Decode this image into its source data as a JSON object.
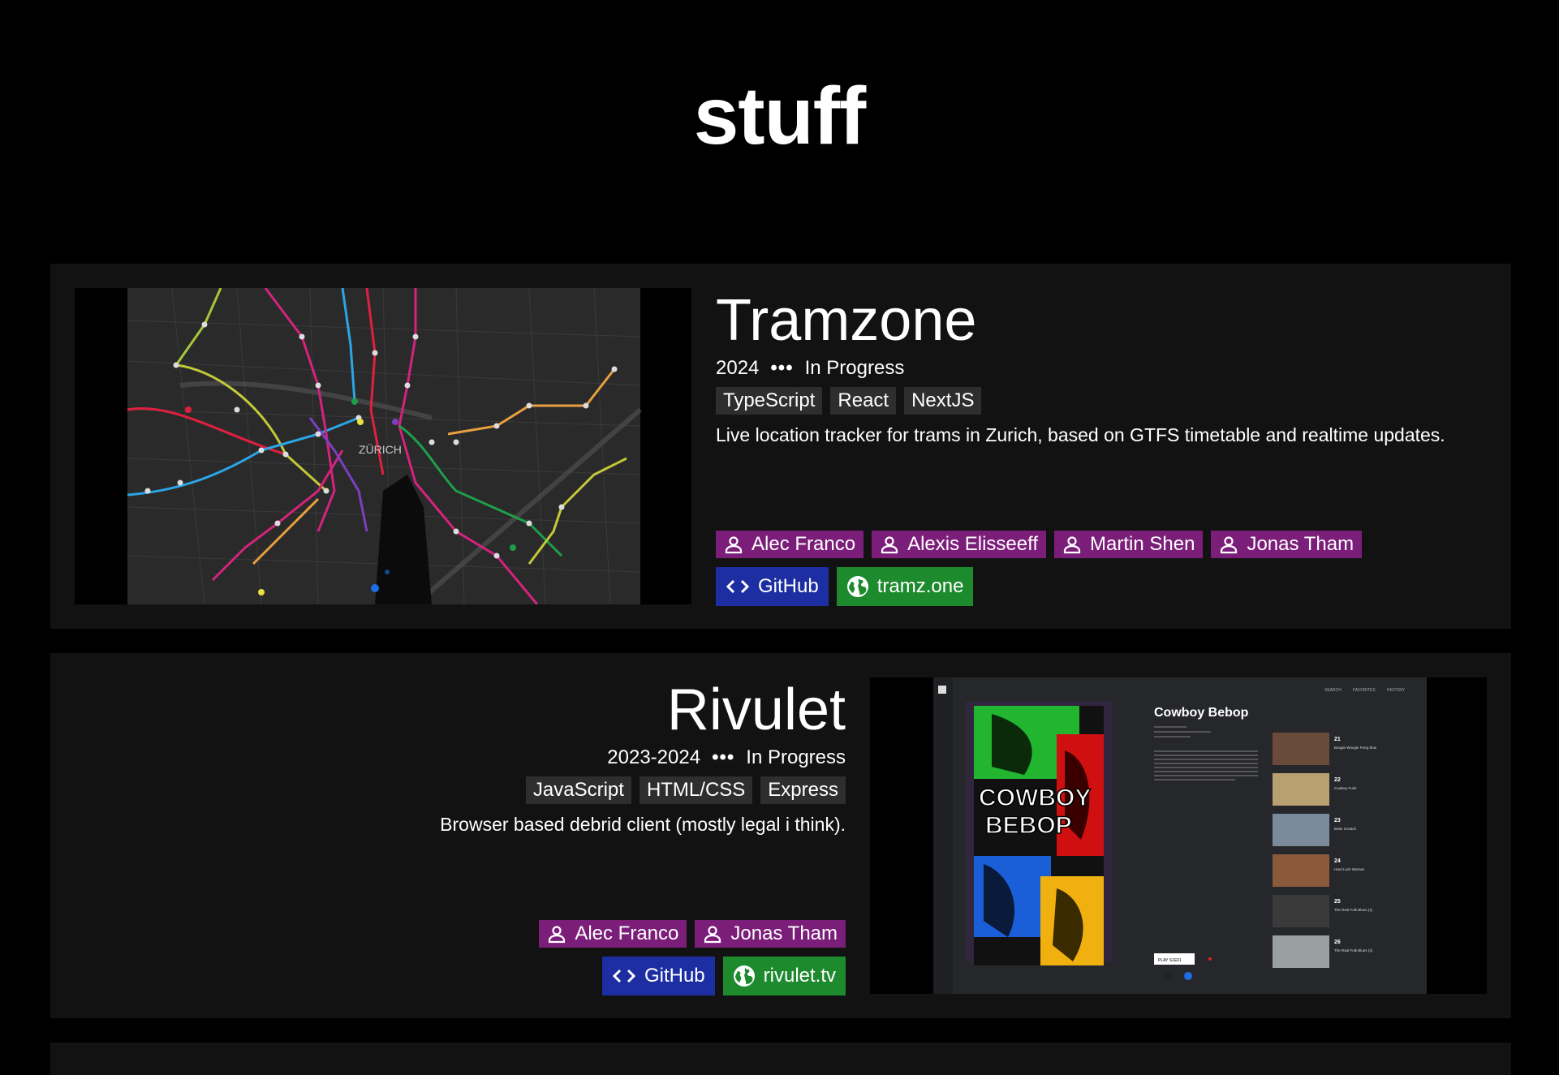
{
  "page": {
    "title": "stuff"
  },
  "projects": [
    {
      "title": "Tramzone",
      "year": "2024",
      "separator": "•••",
      "status": "In Progress",
      "tags": [
        "TypeScript",
        "React",
        "NextJS"
      ],
      "description": "Live location tracker for trams in Zurich, based on GTFS timetable and realtime updates.",
      "people": [
        "Alec Franco",
        "Alexis Elisseeff",
        "Martin Shen",
        "Jonas Tham"
      ],
      "github_label": "GitHub",
      "site_label": "tramz.one",
      "map_label": "ZÜRICH"
    },
    {
      "title": "Rivulet",
      "year": "2023-2024",
      "separator": "•••",
      "status": "In Progress",
      "tags": [
        "JavaScript",
        "HTML/CSS",
        "Express"
      ],
      "description": "Browser based debrid client (mostly legal i think).",
      "people": [
        "Alec Franco",
        "Jonas Tham"
      ],
      "github_label": "GitHub",
      "site_label": "rivulet.tv",
      "screen": {
        "show_title": "Cowboy Bebop",
        "poster_text_1": "COWBOY",
        "poster_text_2": "BEBOP",
        "nav": [
          "SEARCH",
          "FAVORITES",
          "HISTORY"
        ],
        "play_label": "PLAY S1E01",
        "episodes": [
          {
            "num": "21",
            "name": "Boogie Woogie Feng Shui"
          },
          {
            "num": "22",
            "name": "Cowboy Funk"
          },
          {
            "num": "23",
            "name": "Brain Scratch"
          },
          {
            "num": "24",
            "name": "Hard Luck Woman"
          },
          {
            "num": "25",
            "name": "The Real Folk Blues (1)"
          },
          {
            "num": "26",
            "name": "The Real Folk Blues (2)"
          }
        ]
      }
    }
  ],
  "colors": {
    "person": "#7b1e7a",
    "github": "#1d2ea2",
    "site": "#1e8a2e",
    "card": "#121212",
    "tag": "#2e2e2e"
  },
  "icons": {
    "person": "person-icon",
    "code": "code-icon",
    "globe": "globe-icon"
  }
}
